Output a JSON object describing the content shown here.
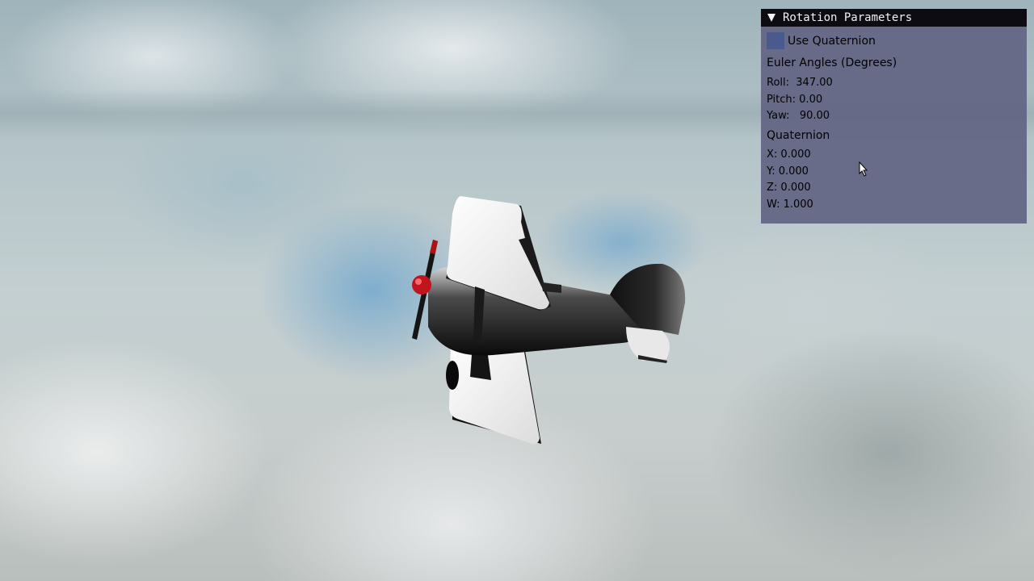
{
  "panel": {
    "title": "Rotation Parameters",
    "use_quaternion_label": "Use Quaternion",
    "use_quaternion_checked": false,
    "euler_heading": "Euler Angles (Degrees)",
    "roll": "Roll:  347.00",
    "pitch": "Pitch: 0.00",
    "yaw": "Yaw:   90.00",
    "quaternion_heading": "Quaternion",
    "qx": "X: 0.000",
    "qy": "Y: 0.000",
    "qz": "Z: 0.000",
    "qw": "W: 1.000"
  },
  "colors": {
    "panel_bg": "#62648a",
    "header_bg": "#0c0c12",
    "checkbox": "#4a5a8c",
    "propeller_hub": "#c0141e"
  },
  "icons": {
    "collapse": "triangle-down-icon",
    "cursor": "mouse-pointer-icon"
  }
}
